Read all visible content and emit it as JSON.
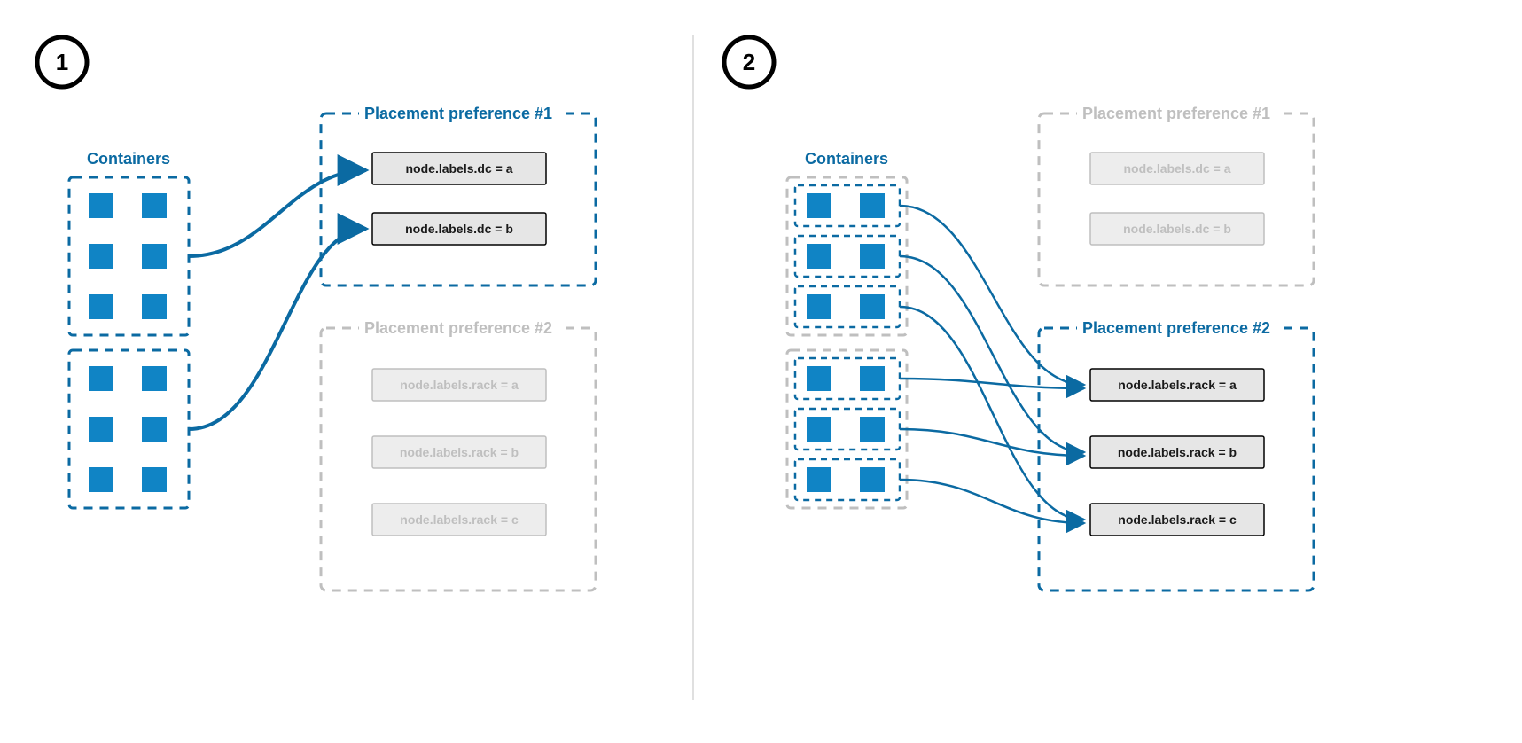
{
  "colors": {
    "blue": "#0b6aa2",
    "blueFill": "#1084c5",
    "grey": "#bfbfbf",
    "boxFill": "#e6e6e6",
    "greyBoxFill": "#ededed",
    "black": "#000"
  },
  "panels": {
    "left": {
      "badge": "1",
      "containers_title": "Containers",
      "pref1": {
        "title": "Placement preference #1",
        "items": [
          "node.labels.dc = a",
          "node.labels.dc = b"
        ],
        "active": true
      },
      "pref2": {
        "title": "Placement preference #2",
        "items": [
          "node.labels.rack = a",
          "node.labels.rack = b",
          "node.labels.rack = c"
        ],
        "active": false
      }
    },
    "right": {
      "badge": "2",
      "containers_title": "Containers",
      "pref1": {
        "title": "Placement preference #1",
        "items": [
          "node.labels.dc = a",
          "node.labels.dc = b"
        ],
        "active": false
      },
      "pref2": {
        "title": "Placement preference #2",
        "items": [
          "node.labels.rack = a",
          "node.labels.rack = b",
          "node.labels.rack = c"
        ],
        "active": true
      }
    }
  }
}
